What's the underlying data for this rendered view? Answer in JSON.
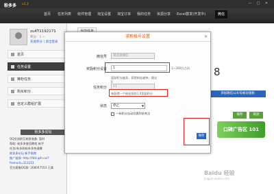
{
  "window": {
    "title": "粉多多",
    "version": "v1.2",
    "controls": [
      "—",
      "□",
      "✕"
    ]
  },
  "nav": [
    {
      "label": "首页"
    },
    {
      "label": "任务列表"
    },
    {
      "label": "收件管理"
    },
    {
      "label": "淘宝设置"
    },
    {
      "label": "淘宝订单"
    },
    {
      "label": "我的任务"
    },
    {
      "label": "资源分享"
    },
    {
      "label": "Excel群发(开发中)"
    },
    {
      "label": "微信"
    }
  ],
  "user": {
    "name": "zu4T1192171",
    "sub": "积分：1 ~",
    "links": "充值积分 | 退出登录"
  },
  "sidebar": {
    "menu": [
      {
        "label": "首页"
      },
      {
        "label": "任务设置"
      },
      {
        "label": "推粉任务"
      },
      {
        "label": "购买积分"
      },
      {
        "label": "自定义群组扩展"
      }
    ],
    "section_title": "粉多多论坛",
    "info": [
      "QQ交流群互粉群准备: 暂时",
      "帮助: 粉多多使用教程 新手",
      "任务(有多款粉多多快速爆",
      "加好友",
      "推广链接: http://fdd.qzh.co/?",
      "fromuid=113151",
      "官方客服QQ群: 268047553 已满"
    ],
    "info_links": [
      "粉多多论坛 新手指南"
    ]
  },
  "main": {
    "tab": "当前任务",
    "big_number": "8",
    "weixin_button": "添加微信公众号被动涨粉",
    "green_buttons": [
      "保存",
      "取消"
    ],
    "banner": "口碑广告区 101"
  },
  "modal": {
    "title": "求粉帐号设置",
    "close": "×",
    "fields": [
      {
        "label": "微信号",
        "value": "请选择微信",
        "disabled": true
      },
      {
        "label": "奖励积分设置",
        "value": "1",
        "suffix": "1~300分之间"
      },
      {
        "label": "",
        "hint1": "奖励积分越多，获得粉丝越快，建议",
        "hint2": "6"
      },
      {
        "label": "任务积分",
        "value": "11",
        "disabled": true
      },
      {
        "label": "",
        "hint": "每获得一个粉丝扣除1.0奖励积分"
      },
      {
        "label": "状态",
        "value": "停止"
      }
    ],
    "checkbox_label": "一有积分自动切换到求关注",
    "save": "保存"
  },
  "watermark": {
    "text": "Baidu 经验",
    "sub": "jingyan.baidu.com"
  },
  "colors": {
    "accent": "#2b66b8",
    "highlight": "#e02020",
    "title": "#e05a00"
  }
}
